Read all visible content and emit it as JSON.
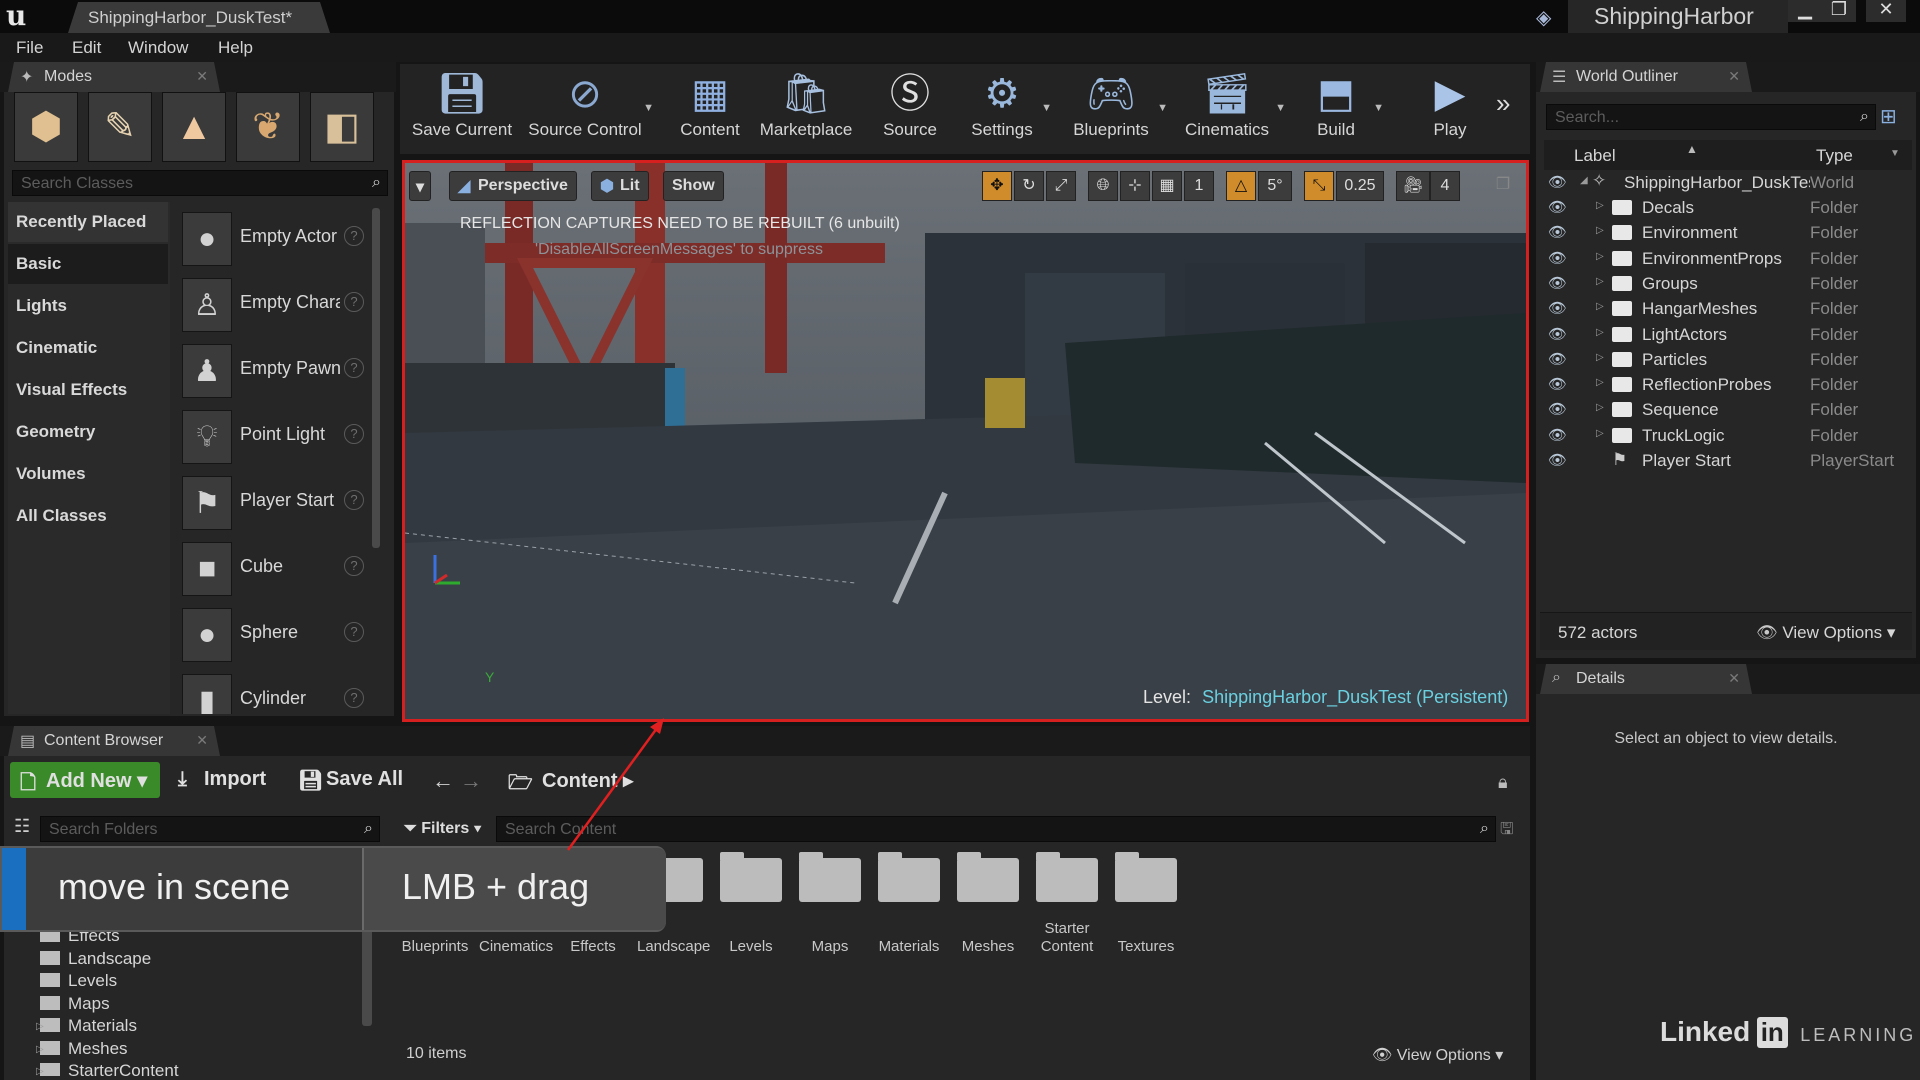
{
  "titlebar": {
    "logo": "u",
    "doc_tab": "ShippingHarbor_DuskTest*",
    "project_name": "ShippingHarbor",
    "win_minimize": "▁",
    "win_restore": "❐",
    "win_close": "✕"
  },
  "menu": [
    "File",
    "Edit",
    "Window",
    "Help"
  ],
  "modes": {
    "tab": "Modes",
    "search_placeholder": "Search Classes",
    "categories": [
      "Recently Placed",
      "Basic",
      "Lights",
      "Cinematic",
      "Visual Effects",
      "Geometry",
      "Volumes",
      "All Classes"
    ],
    "selected_category": "Basic",
    "actors": [
      "Empty Actor",
      "Empty Character",
      "Empty Pawn",
      "Point Light",
      "Player Start",
      "Cube",
      "Sphere",
      "Cylinder"
    ],
    "mode_icons": [
      "place-mode-icon",
      "paint-mode-icon",
      "landscape-mode-icon",
      "foliage-mode-icon",
      "geometry-mode-icon"
    ]
  },
  "toolbar": {
    "buttons": [
      "Save Current",
      "Source Control",
      "Content",
      "Marketplace",
      "Source",
      "Settings",
      "Blueprints",
      "Cinematics",
      "Build",
      "Play"
    ]
  },
  "viewport": {
    "perspective": "Perspective",
    "lit": "Lit",
    "show": "Show",
    "warning": "REFLECTION CAPTURES NEED TO BE REBUILT (6 unbuilt)",
    "subwarning": "'DisableAllScreenMessages' to suppress",
    "grid_snap": "1",
    "rot_snap": "5°",
    "scale_snap": "0.25",
    "cam_speed": "4",
    "level_label": "Level:",
    "level_name": "ShippingHarbor_DuskTest (Persistent)",
    "axis_y": "Y",
    "accent": "#d61f1f"
  },
  "outliner": {
    "tab": "World Outliner",
    "search_placeholder": "Search...",
    "col_label": "Label",
    "col_type": "Type",
    "root": {
      "label": "ShippingHarbor_DuskTest (Editor)",
      "type": "World"
    },
    "rows": [
      {
        "label": "Decals",
        "type": "Folder"
      },
      {
        "label": "Environment",
        "type": "Folder"
      },
      {
        "label": "EnvironmentProps",
        "type": "Folder"
      },
      {
        "label": "Groups",
        "type": "Folder"
      },
      {
        "label": "HangarMeshes",
        "type": "Folder"
      },
      {
        "label": "LightActors",
        "type": "Folder"
      },
      {
        "label": "Particles",
        "type": "Folder"
      },
      {
        "label": "ReflectionProbes",
        "type": "Folder"
      },
      {
        "label": "Sequence",
        "type": "Folder"
      },
      {
        "label": "TruckLogic",
        "type": "Folder"
      }
    ],
    "player_start": {
      "label": "Player Start",
      "type": "PlayerStart"
    },
    "actor_count": "572 actors",
    "view_options": "View Options"
  },
  "details": {
    "tab": "Details",
    "empty": "Select an object to view details."
  },
  "content_browser": {
    "tab": "Content Browser",
    "add_new": "Add New",
    "import": "Import",
    "save_all": "Save All",
    "path": "Content",
    "search_folders": "Search Folders",
    "filters": "Filters",
    "search_content": "Search Content",
    "tree": [
      "Effects",
      "Landscape",
      "Levels",
      "Maps",
      "Materials",
      "Meshes",
      "StarterContent"
    ],
    "tree_expandable": [
      false,
      false,
      false,
      false,
      true,
      true,
      true
    ],
    "folders": [
      "Blueprints",
      "Cinematics",
      "Effects",
      "Landscape",
      "Levels",
      "Maps",
      "Materials",
      "Meshes",
      "Starter Content",
      "Textures"
    ],
    "item_count": "10 items",
    "view_options": "View Options",
    "add_new_color": "#3a8a2a"
  },
  "overlay": {
    "action": "move in scene",
    "shortcut": "LMB + drag",
    "accent": "#1a6fc0"
  },
  "watermark": {
    "linked": "Linked",
    "in": "in",
    "learning": "LEARNING"
  }
}
